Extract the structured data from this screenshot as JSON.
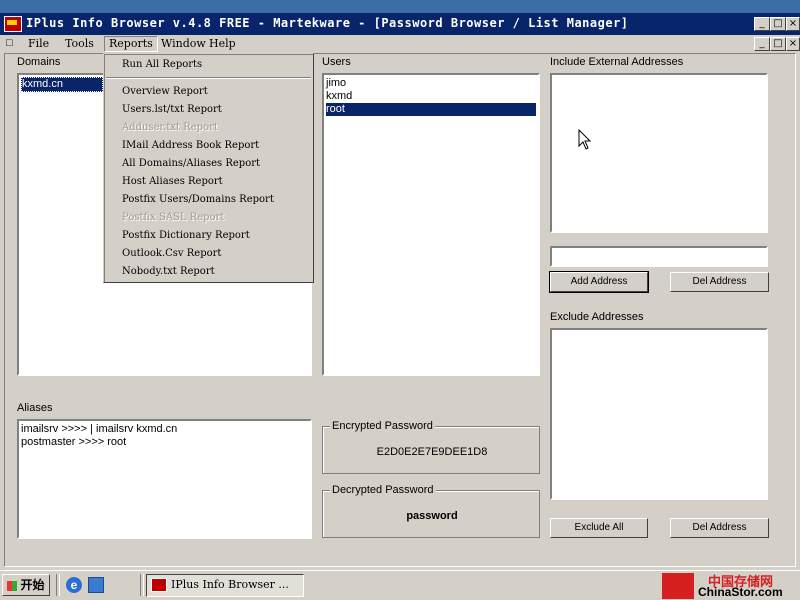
{
  "window": {
    "title": "IPlus Info Browser v.4.8 FREE - Martekware - [Password Browser / List Manager]",
    "min_glyph": "_",
    "max_glyph": "□",
    "close_glyph": "×"
  },
  "menubar": {
    "doc_icon": "□",
    "items": [
      "File",
      "Tools",
      "Reports",
      "Window",
      "Help"
    ],
    "active": "Reports"
  },
  "reports_menu": {
    "items": [
      {
        "label": "Run All Reports",
        "enabled": true
      },
      {
        "label": "Overview Report",
        "enabled": true
      },
      {
        "label": "Users.lst/txt Report",
        "enabled": true
      },
      {
        "label": "Adduser.txt Report",
        "enabled": false
      },
      {
        "label": "IMail Address Book Report",
        "enabled": true
      },
      {
        "label": "All Domains/Aliases Report",
        "enabled": true
      },
      {
        "label": "Host Aliases Report",
        "enabled": true
      },
      {
        "label": "Postfix Users/Domains Report",
        "enabled": true
      },
      {
        "label": "Postfix SASL Report",
        "enabled": false
      },
      {
        "label": "Postfix Dictionary Report",
        "enabled": true
      },
      {
        "label": "Outlook.Csv Report",
        "enabled": true
      },
      {
        "label": "Nobody.txt Report",
        "enabled": true
      }
    ]
  },
  "domains": {
    "label": "Domains",
    "items": [
      "kxmd.cn"
    ],
    "selected": 0
  },
  "users": {
    "label": "Users",
    "items": [
      "jimo",
      "kxmd",
      "root"
    ],
    "selected": 2
  },
  "aliases": {
    "label": "Aliases",
    "items": [
      "imailsrv >>>> | imailsrv kxmd.cn",
      "postmaster >>>> root"
    ]
  },
  "encrypted": {
    "label": "Encrypted Password",
    "value": "E2D0E2E7E9DEE1D8"
  },
  "decrypted": {
    "label": "Decrypted Password",
    "value": "password"
  },
  "include": {
    "label": "Include External Addresses",
    "input_value": "",
    "add_label": "Add Address",
    "del_label": "Del Address"
  },
  "exclude": {
    "label": "Exclude Addresses",
    "all_label": "Exclude All",
    "del_label": "Del Address"
  },
  "taskbar": {
    "start_label": "开始",
    "task_label": "IPlus Info Browser ...",
    "watermark_cn": "中国存储网",
    "watermark_en": "ChinaStor.com"
  },
  "colors": {
    "title_bg": "#08246b",
    "selection": "#0a246a",
    "face": "#d4d0c8"
  }
}
